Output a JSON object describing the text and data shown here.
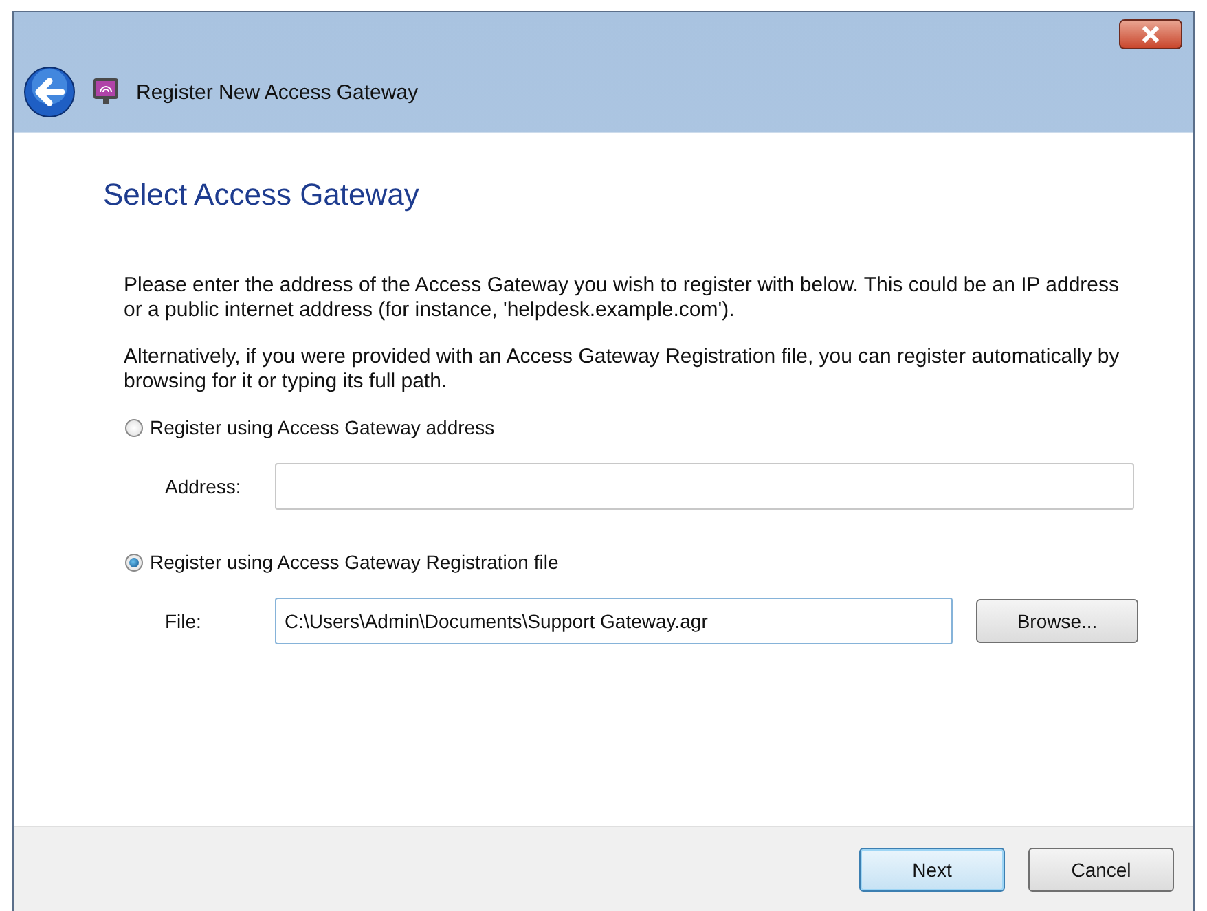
{
  "window": {
    "title": "Register New Access Gateway"
  },
  "heading": "Select Access Gateway",
  "paragraphs": [
    "Please enter the address of the Access Gateway you wish to register with below.  This could be an IP address or a public internet address (for instance, 'helpdesk.example.com').",
    "Alternatively, if you were provided with an Access Gateway Registration file, you can register automatically by browsing for it or typing its full path."
  ],
  "options": [
    {
      "label": "Register using Access Gateway address",
      "selected": false,
      "field": {
        "label": "Address:"
      }
    },
    {
      "label": "Register using Access Gateway Registration file",
      "selected": true,
      "field": {
        "label": "File:",
        "value": "C:\\Users\\Admin\\Documents\\Support Gateway.agr",
        "button": "Browse..."
      }
    }
  ],
  "buttons": [
    {
      "label": "Next",
      "default": true
    },
    {
      "label": "Cancel",
      "default": false
    }
  ]
}
